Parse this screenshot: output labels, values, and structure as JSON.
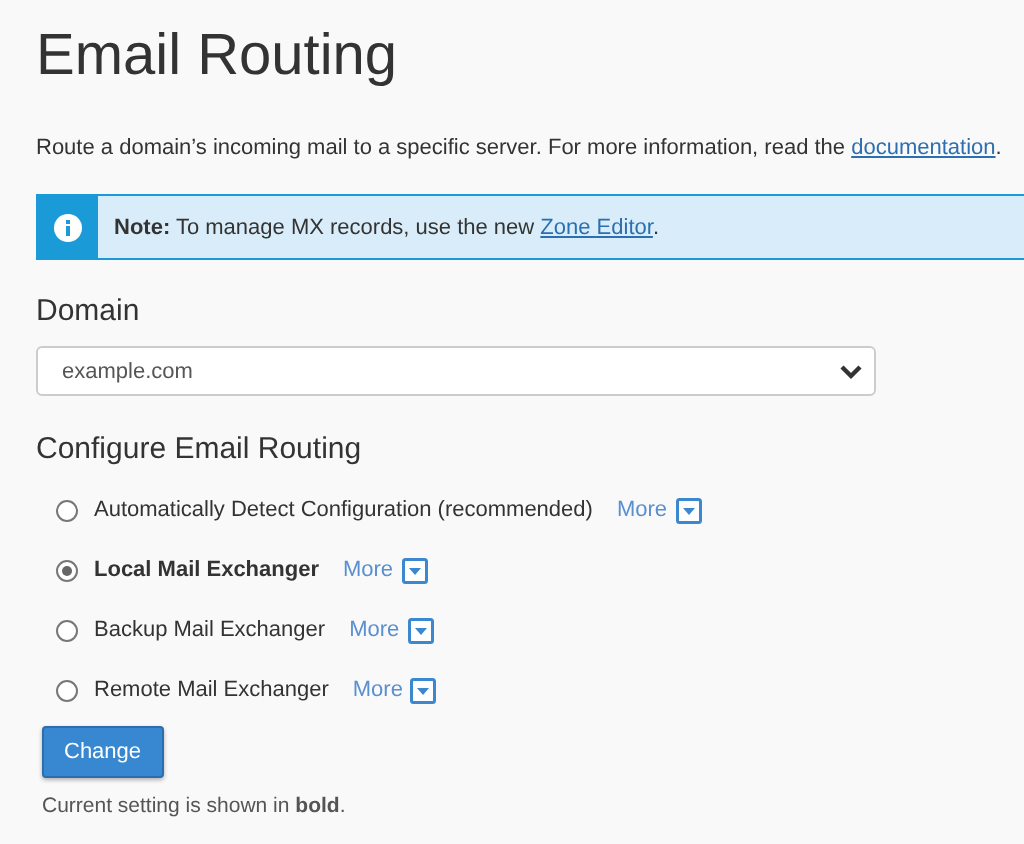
{
  "title": "Email Routing",
  "intro": {
    "text": "Route a domain’s incoming mail to a specific server. For more information, read the ",
    "link": "documentation",
    "after": "."
  },
  "note": {
    "text": "**Note:** To manage MX records, use the new ",
    "link": "Zone Editor",
    "after": "."
  },
  "domain": {
    "label": "Domain",
    "value": "example.com"
  },
  "routing": {
    "heading": "Configure Email Routing",
    "options": [
      {
        "label": "Automatically Detect Configuration (recommended)",
        "selected": false,
        "more": "More"
      },
      {
        "label": "Local Mail Exchanger",
        "selected": true,
        "more": "More"
      },
      {
        "label": "Backup Mail Exchanger",
        "selected": false,
        "more": "More"
      },
      {
        "label": "Remote Mail Exchanger",
        "selected": false,
        "more": "More"
      }
    ]
  },
  "button": "Change",
  "footer": "Current setting is shown in **bold**."
}
